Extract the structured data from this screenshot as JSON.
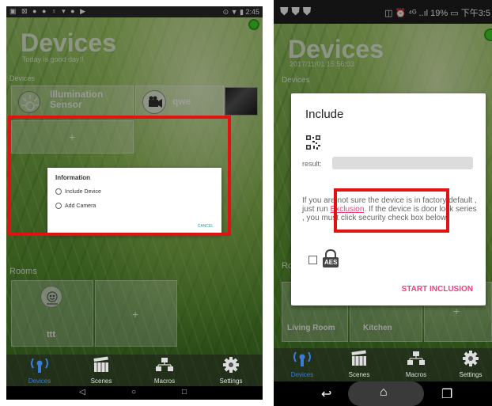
{
  "left": {
    "status": {
      "left_icons": "▣ ⊠ ● ● ♀ ▾ ● ▶",
      "right_text": "⊙ ▼ ▮ 2:45"
    },
    "title": "Devices",
    "subtitle": "Today is good day!!",
    "devices_section": "Devices",
    "device_cards": [
      {
        "label": "Illumination Sensor"
      },
      {
        "label": "qwe"
      }
    ],
    "add_symbol": "+",
    "dialog": {
      "title": "Information",
      "options": [
        "Include Device",
        "Add Camera"
      ],
      "cancel": "CANCEL"
    },
    "rooms_section": "Rooms",
    "room_cards": [
      {
        "label": "ttt"
      }
    ],
    "room_add_symbol": "+",
    "nav": [
      "Devices",
      "Scenes",
      "Macros",
      "Settings"
    ],
    "sys": {
      "back": "◁",
      "home": "○",
      "recent": "□"
    }
  },
  "right": {
    "status": {
      "right_text": "◫ ⏰ ⁴ᴳ ..ıl 19% ▭ 下午3:5"
    },
    "title": "Devices",
    "subtitle": "2017/11/01 15:56:03",
    "devices_section": "Devices",
    "dialog": {
      "title": "Include",
      "result_label": "result:",
      "message_prefix": "If you are not sure the device is in factory default , just run ",
      "exclusion_link": "Exclusion",
      "message_suffix": ". If the device is door lock series , you must click security check box below.",
      "aes_label": "AES",
      "start": "START INCLUSION"
    },
    "rooms_section": "Rooms",
    "room_cards": [
      {
        "label": "Living Room"
      },
      {
        "label": "Kitchen"
      }
    ],
    "nav": [
      "Devices",
      "Scenes",
      "Macros",
      "Settings"
    ],
    "sys": {
      "back": "↩",
      "home": "⌂",
      "recent": "❐"
    }
  },
  "colors": {
    "highlight": "#e01212",
    "accent_pink": "#e8437a",
    "dot_green": "#44d62c"
  }
}
